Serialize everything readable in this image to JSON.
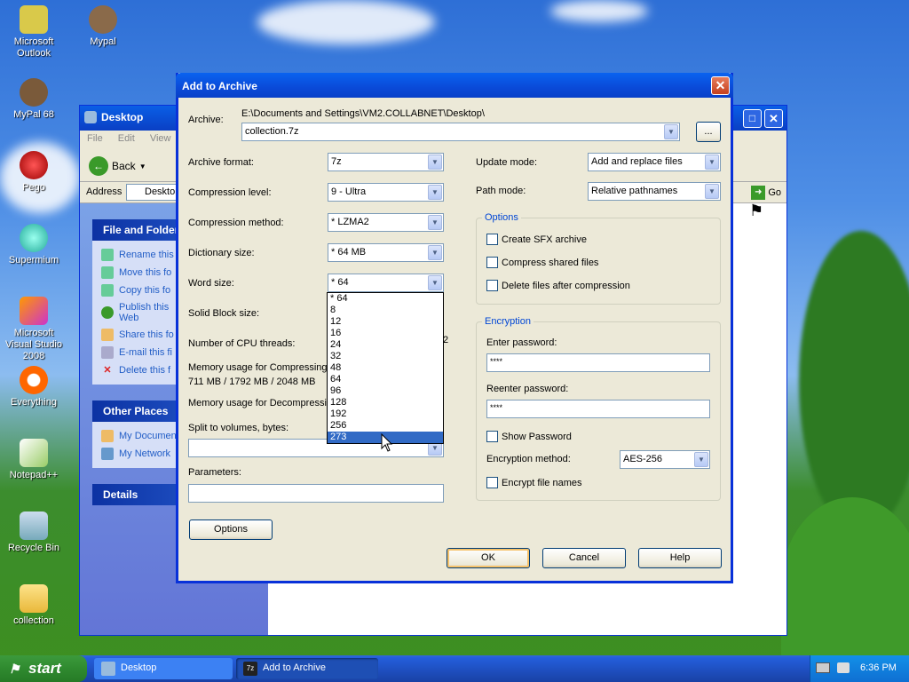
{
  "desktop": {
    "icons": [
      {
        "label": "Microsoft Outlook",
        "name": "outlook"
      },
      {
        "label": "Mypal",
        "name": "mypal"
      },
      {
        "label": "MyPal 68",
        "name": "mypal68"
      },
      {
        "label": "Pego",
        "name": "pego"
      },
      {
        "label": "Supermium",
        "name": "supermium"
      },
      {
        "label": "Microsoft Visual Studio 2008",
        "name": "vs2008"
      },
      {
        "label": "Everything",
        "name": "everything"
      },
      {
        "label": "Notepad++",
        "name": "notepadpp"
      },
      {
        "label": "Recycle Bin",
        "name": "recycle-bin"
      },
      {
        "label": "collection",
        "name": "collection-folder"
      }
    ]
  },
  "explorer": {
    "title": "Desktop",
    "menu": [
      "File",
      "Edit",
      "View"
    ],
    "back_label": "Back",
    "address_label": "Address",
    "address_value": "Deskto",
    "go_label": "Go",
    "file_folder_title": "File and Folder",
    "file_tasks": [
      "Rename this",
      "Move this fo",
      "Copy this fo",
      "Publish this Web",
      "Share this fo",
      "E-mail this fi",
      "Delete this f"
    ],
    "other_places_title": "Other Places",
    "other_places": [
      "My Documen",
      "My Network"
    ],
    "details_title": "Details"
  },
  "dialog": {
    "title": "Add to Archive",
    "archive_label": "Archive:",
    "archive_path": "E:\\Documents and Settings\\VM2.COLLABNET\\Desktop\\",
    "archive_name": "collection.7z",
    "browse_label": "...",
    "format_label": "Archive format:",
    "format_value": "7z",
    "level_label": "Compression level:",
    "level_value": "9 - Ultra",
    "method_label": "Compression method:",
    "method_value": "* LZMA2",
    "dict_label": "Dictionary size:",
    "dict_value": "* 64 MB",
    "word_label": "Word size:",
    "word_value": "* 64",
    "solid_label": "Solid Block size:",
    "threads_label": "Number of CPU threads:",
    "threads_partial": "2",
    "mem_comp_label": "Memory usage for Compressing:",
    "mem_comp_value": "711 MB / 1792 MB / 2048 MB",
    "mem_decomp_label": "Memory usage for Decompressing:",
    "split_label": "Split to volumes, bytes:",
    "params_label": "Parameters:",
    "options_button": "Options",
    "update_label": "Update mode:",
    "update_value": "Add and replace files",
    "path_label": "Path mode:",
    "path_value": "Relative pathnames",
    "options_group": "Options",
    "opt_sfx": "Create SFX archive",
    "opt_shared": "Compress shared files",
    "opt_delete": "Delete files after compression",
    "encryption_group": "Encryption",
    "enter_pw_label": "Enter password:",
    "enter_pw_value": "****",
    "reenter_pw_label": "Reenter password:",
    "reenter_pw_value": "****",
    "show_pw": "Show Password",
    "enc_method_label": "Encryption method:",
    "enc_method_value": "AES-256",
    "encrypt_names": "Encrypt file names",
    "ok": "OK",
    "cancel": "Cancel",
    "help": "Help",
    "word_options": [
      "* 64",
      "8",
      "12",
      "16",
      "24",
      "32",
      "48",
      "64",
      "96",
      "128",
      "192",
      "256",
      "273"
    ],
    "word_selected": "273"
  },
  "taskbar": {
    "start": "start",
    "tasks": [
      {
        "label": "Desktop"
      },
      {
        "label": "Add to Archive"
      }
    ],
    "clock": "6:36 PM"
  }
}
